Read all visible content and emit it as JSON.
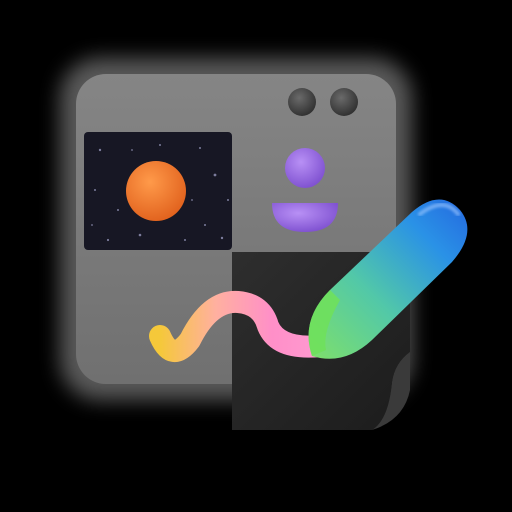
{
  "icon": {
    "name": "drawing-app-icon",
    "background": "#000000",
    "colors": {
      "window": "#7a7a7a",
      "window_glow": "#ffffff",
      "window_dots": "#3d3d3d",
      "photo_panel": "#1a1a28",
      "sun": "#f57a2c",
      "avatar": "#9b6ae0",
      "canvas_sheet": "#262626",
      "stroke_start": "#f5c83a",
      "stroke_mid": "#ff8fc8",
      "pencil_tip": "#72d96a",
      "pencil_body": "#2a7bea"
    }
  }
}
